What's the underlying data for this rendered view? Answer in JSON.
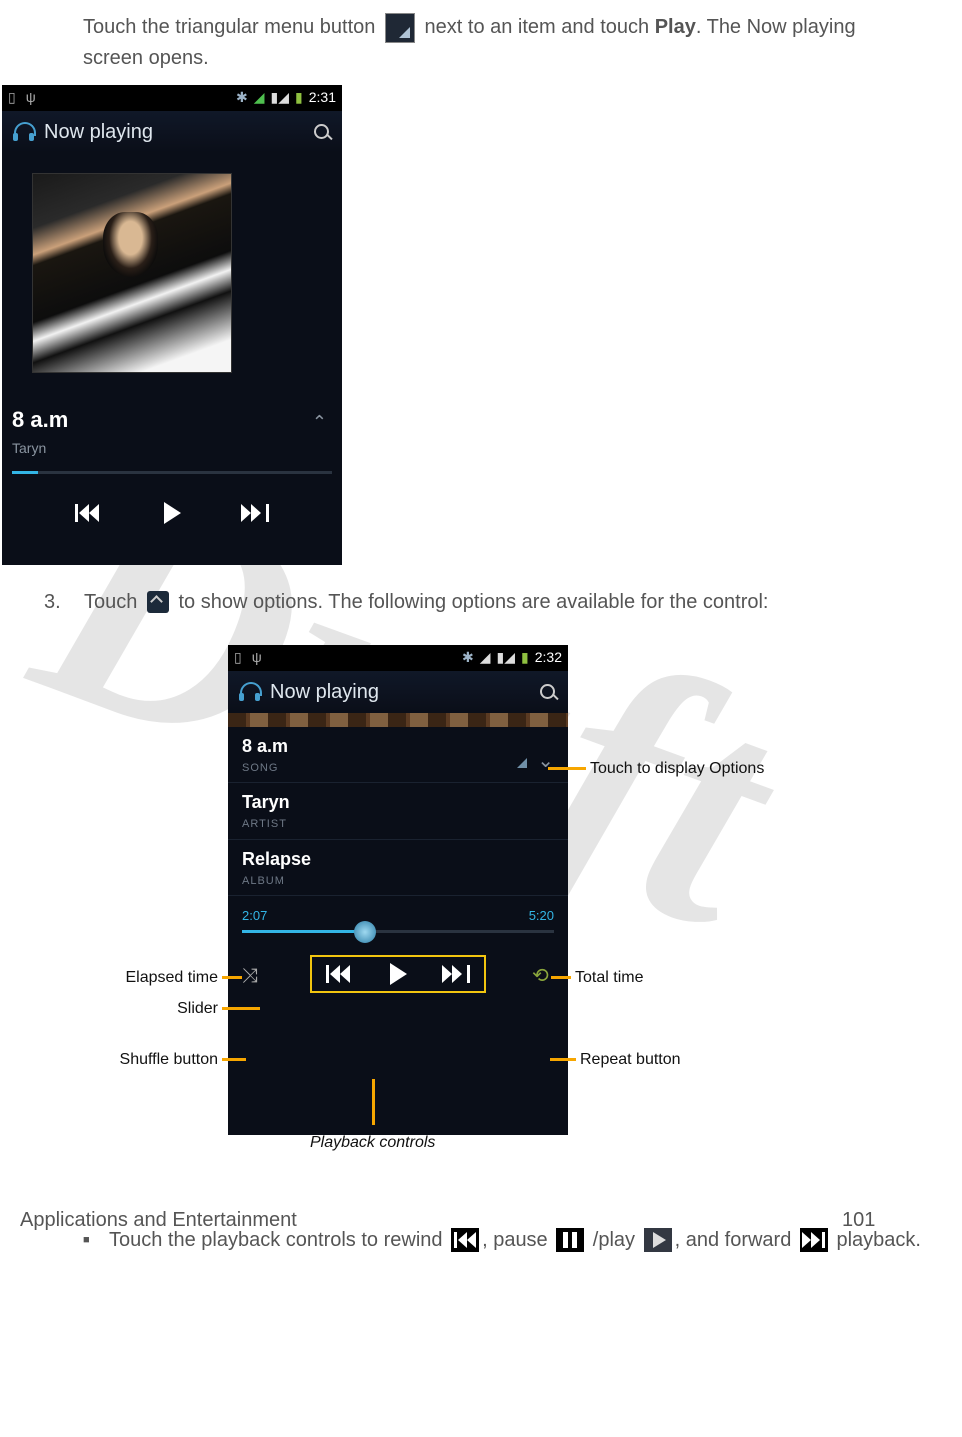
{
  "intro": {
    "t1": "Touch the triangular menu button ",
    "t2": " next to an item and touch ",
    "bold": "Play",
    "t3": ". The Now playing screen opens."
  },
  "watermark": "Draft",
  "phone1": {
    "time": "2:31",
    "np": "Now playing",
    "title": "8 a.m",
    "artist": "Taryn"
  },
  "step3": {
    "num": "3.",
    "t1": "Touch ",
    "t2": " to show options. The following options are available for the control:"
  },
  "phone2": {
    "time": "2:32",
    "np": "Now playing",
    "song": "8 a.m",
    "song_lbl": "SONG",
    "artist": "Taryn",
    "artist_lbl": "ARTIST",
    "album": "Relapse",
    "album_lbl": "ALBUM",
    "elapsed": "2:07",
    "total": "5:20"
  },
  "ann": {
    "opts": "Touch to display Options",
    "elapsed": "Elapsed time",
    "total": "Total time",
    "slider": "Slider",
    "shuffle": "Shuffle button",
    "repeat": "Repeat button",
    "playback": "Playback controls"
  },
  "bullet": {
    "t1": "Touch the playback controls to rewind ",
    "t2": ", pause ",
    "t3": " /play ",
    "t4": ", and forward ",
    "t5": " playback."
  },
  "footer": {
    "section": "Applications and Entertainment",
    "page": "101"
  }
}
